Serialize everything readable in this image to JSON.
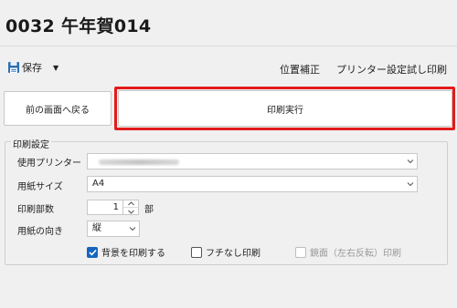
{
  "page": {
    "title": "0032 午年賀014"
  },
  "toolbar": {
    "save_label": "保存",
    "save_icon": "save-icon",
    "links": [
      "位置補正",
      "プリンター設定",
      "試し印刷"
    ]
  },
  "actions": {
    "back_label": "前の画面へ戻る",
    "execute_label": "印刷実行",
    "highlight_color": "#e31b1b"
  },
  "settings": {
    "legend": "印刷設定",
    "printer": {
      "label": "使用プリンター",
      "value": ""
    },
    "paper_size": {
      "label": "用紙サイズ",
      "value": "A4"
    },
    "copies": {
      "label": "印刷部数",
      "value": "1",
      "unit": "部"
    },
    "orientation": {
      "label": "用紙の向き",
      "value": "縦"
    },
    "checkboxes": [
      {
        "label": "背景を印刷する",
        "checked": true,
        "enabled": true
      },
      {
        "label": "フチなし印刷",
        "checked": false,
        "enabled": true
      },
      {
        "label": "鏡面（左右反転）印刷",
        "checked": false,
        "enabled": false
      }
    ]
  },
  "colors": {
    "accent": "#1565c0",
    "background": "#f0f0f0"
  }
}
